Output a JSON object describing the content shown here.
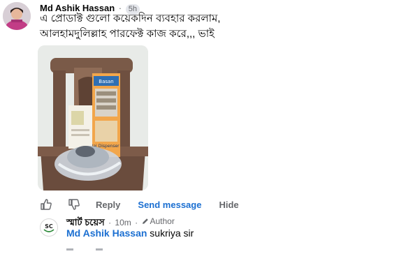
{
  "comment": {
    "author": "Md Ashik Hassan",
    "separator": "·",
    "time": "5h",
    "text_line1": "এ প্রোডাক্ট গুলো কয়েকদিন ব্যবহার করলাম,",
    "text_line2": "আলহামদুলিল্লাহ পারফেক্ট কাজ করে,,, ভাই",
    "photo": {
      "box_label_top": "Basan",
      "box_label_bottom": "Rai\nDispenser"
    }
  },
  "actions": {
    "reply": "Reply",
    "send_message": "Send message",
    "hide": "Hide"
  },
  "reply": {
    "avatar_text": "SC",
    "author": "স্মার্ট চয়েস",
    "separator": "·",
    "time": "10m",
    "author_badge": "Author",
    "mention": "Md Ashik Hassan",
    "text": "sukriya sir"
  },
  "colors": {
    "link_blue": "#1b6fd1",
    "muted": "#65676b",
    "text": "#050505"
  }
}
